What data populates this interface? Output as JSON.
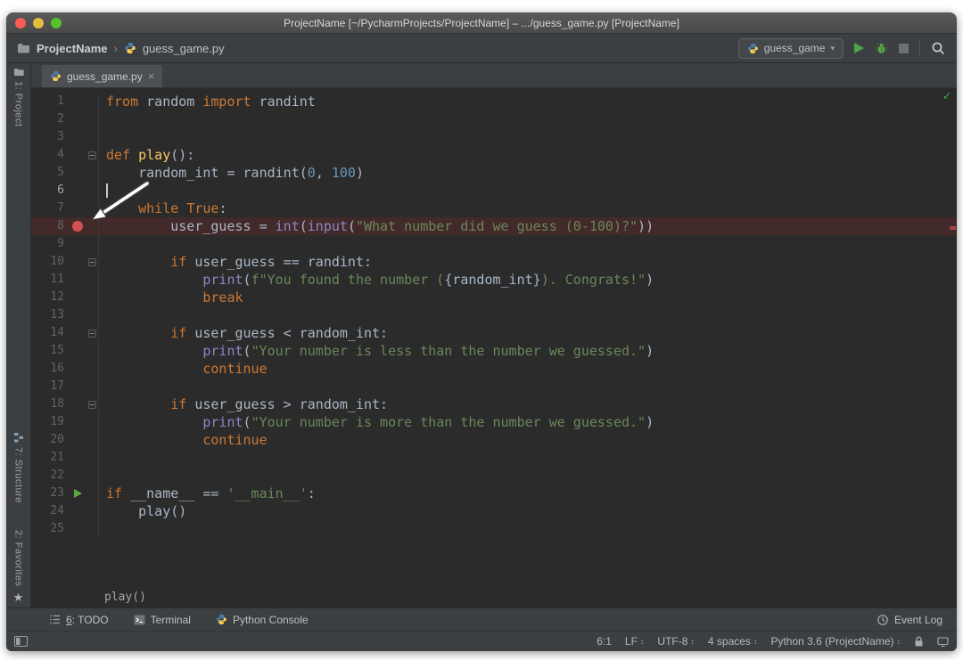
{
  "window_title": "ProjectName [~/PycharmProjects/ProjectName] – .../guess_game.py [ProjectName]",
  "navbar": {
    "project": "ProjectName",
    "separator": "›",
    "file": "guess_game.py",
    "run_config": "guess_game",
    "dropdown_arrow": "▾"
  },
  "stripe": {
    "project": "1: Project",
    "structure": "7: Structure",
    "favorites": "2: Favorites",
    "star": "★"
  },
  "tab": {
    "label": "guess_game.py",
    "close": "×"
  },
  "editor": {
    "inspection_ok": "✓",
    "breadcrumb": "play()",
    "lines": [
      {
        "n": 1,
        "segs": [
          [
            "kw",
            "from"
          ],
          [
            "pl",
            " random "
          ],
          [
            "kw",
            "import"
          ],
          [
            "pl",
            " randint"
          ]
        ]
      },
      {
        "n": 2,
        "segs": []
      },
      {
        "n": 3,
        "segs": []
      },
      {
        "n": 4,
        "fold": true,
        "segs": [
          [
            "kw",
            "def "
          ],
          [
            "fn",
            "play"
          ],
          [
            "pl",
            "():"
          ]
        ]
      },
      {
        "n": 5,
        "segs": [
          [
            "pl",
            "    random_int = randint("
          ],
          [
            "num",
            "0"
          ],
          [
            "pl",
            ", "
          ],
          [
            "num",
            "100"
          ],
          [
            "pl",
            ")"
          ]
        ]
      },
      {
        "n": 6,
        "cur": true,
        "segs": []
      },
      {
        "n": 7,
        "segs": [
          [
            "pl",
            "    "
          ],
          [
            "kw",
            "while"
          ],
          [
            "pl",
            " "
          ],
          [
            "kw",
            "True"
          ],
          [
            "pl",
            ":"
          ]
        ]
      },
      {
        "n": 8,
        "bp": true,
        "segs": [
          [
            "pl",
            "        user_guess = "
          ],
          [
            "bi",
            "int"
          ],
          [
            "pl",
            "("
          ],
          [
            "bi",
            "input"
          ],
          [
            "pl",
            "("
          ],
          [
            "str",
            "\"What number did we guess (0-100)?\""
          ],
          [
            "pl",
            "))"
          ]
        ]
      },
      {
        "n": 9,
        "segs": []
      },
      {
        "n": 10,
        "fold": true,
        "segs": [
          [
            "pl",
            "        "
          ],
          [
            "kw",
            "if"
          ],
          [
            "pl",
            " user_guess == randint:"
          ]
        ]
      },
      {
        "n": 11,
        "segs": [
          [
            "pl",
            "            "
          ],
          [
            "bi",
            "print"
          ],
          [
            "pl",
            "("
          ],
          [
            "str",
            "f\"You found the number ("
          ],
          [
            "fx",
            "{random_int}"
          ],
          [
            "str",
            "). Congrats!\""
          ],
          [
            "pl",
            ")"
          ]
        ]
      },
      {
        "n": 12,
        "segs": [
          [
            "pl",
            "            "
          ],
          [
            "kw",
            "break"
          ]
        ]
      },
      {
        "n": 13,
        "segs": []
      },
      {
        "n": 14,
        "fold": true,
        "segs": [
          [
            "pl",
            "        "
          ],
          [
            "kw",
            "if"
          ],
          [
            "pl",
            " user_guess < random_int:"
          ]
        ]
      },
      {
        "n": 15,
        "segs": [
          [
            "pl",
            "            "
          ],
          [
            "bi",
            "print"
          ],
          [
            "pl",
            "("
          ],
          [
            "str",
            "\"Your number is less than the number we guessed.\""
          ],
          [
            "pl",
            ")"
          ]
        ]
      },
      {
        "n": 16,
        "segs": [
          [
            "pl",
            "            "
          ],
          [
            "kw",
            "continue"
          ]
        ]
      },
      {
        "n": 17,
        "segs": []
      },
      {
        "n": 18,
        "fold": true,
        "segs": [
          [
            "pl",
            "        "
          ],
          [
            "kw",
            "if"
          ],
          [
            "pl",
            " user_guess > random_int:"
          ]
        ]
      },
      {
        "n": 19,
        "segs": [
          [
            "pl",
            "            "
          ],
          [
            "bi",
            "print"
          ],
          [
            "pl",
            "("
          ],
          [
            "str",
            "\"Your number is more than the number we guessed.\""
          ],
          [
            "pl",
            ")"
          ]
        ]
      },
      {
        "n": 20,
        "segs": [
          [
            "pl",
            "            "
          ],
          [
            "kw",
            "continue"
          ]
        ]
      },
      {
        "n": 21,
        "segs": []
      },
      {
        "n": 22,
        "segs": []
      },
      {
        "n": 23,
        "run": true,
        "segs": [
          [
            "kw",
            "if"
          ],
          [
            "pl",
            " __name__ == "
          ],
          [
            "str",
            "'__main__'"
          ],
          [
            "pl",
            ":"
          ]
        ]
      },
      {
        "n": 24,
        "segs": [
          [
            "pl",
            "    play()"
          ]
        ]
      },
      {
        "n": 25,
        "segs": []
      }
    ]
  },
  "toolbar": {
    "todo_num": "6",
    "todo_rest": ": TODO",
    "terminal": "Terminal",
    "python_console": "Python Console",
    "event_log": "Event Log"
  },
  "statusbar": {
    "position": "6:1",
    "line_ending": "LF",
    "encoding": "UTF-8",
    "indent": "4 spaces",
    "interpreter": "Python 3.6 (ProjectName)",
    "arrow": "↕"
  },
  "colors": {
    "editor_bg": "#2b2b2b",
    "chrome_bg": "#3c3f41",
    "keyword": "#cc7832",
    "string": "#6a8759",
    "number": "#6897bb",
    "builtin": "#8888c6",
    "function_def": "#ffc66b",
    "plain_text": "#a9b7c6",
    "breakpoint_line": "#432a2a",
    "breakpoint_dot": "#d25252",
    "run_green": "#4ca64c"
  }
}
